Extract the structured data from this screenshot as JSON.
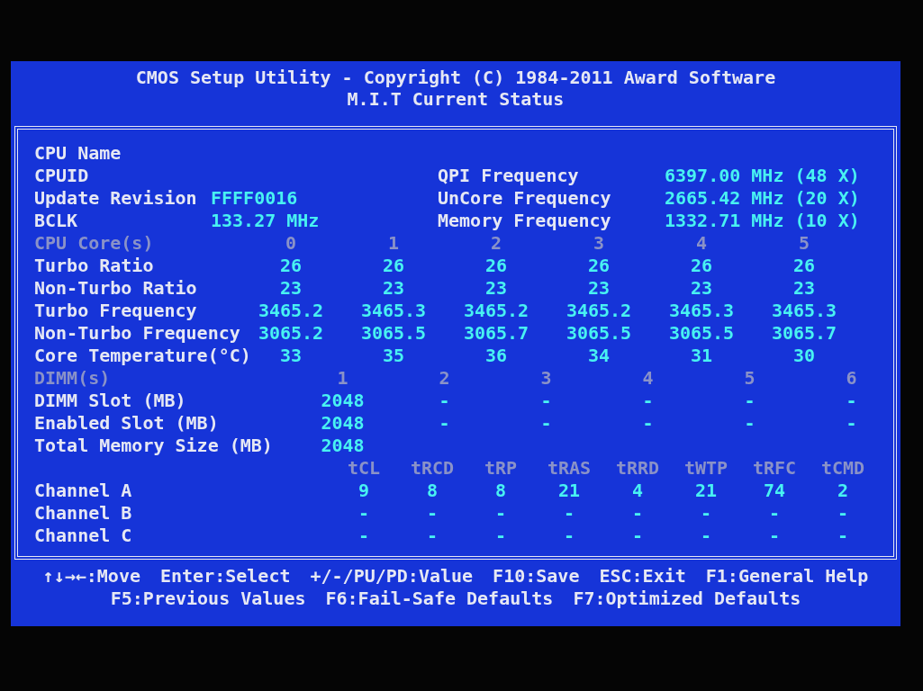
{
  "header": {
    "title": "CMOS Setup Utility - Copyright (C) 1984-2011 Award Software",
    "subtitle": "M.I.T Current Status"
  },
  "cpu_info": {
    "left": [
      {
        "label": "CPU Name"
      },
      {
        "label": "CPUID"
      },
      {
        "label": "Update Revision",
        "value": "FFFF0016"
      },
      {
        "label": "BCLK",
        "value": "133.27 MHz"
      }
    ],
    "right": [
      {
        "label": "QPI Frequency",
        "value": "6397.00 MHz (48 X)"
      },
      {
        "label": "UnCore Frequency",
        "value": "2665.42 MHz (20 X)"
      },
      {
        "label": "Memory Frequency",
        "value": "1332.71 MHz (10 X)"
      }
    ]
  },
  "cpu_cores": {
    "heading": "CPU Core(s)",
    "columns": [
      "0",
      "1",
      "2",
      "3",
      "4",
      "5"
    ],
    "rows": [
      {
        "label": "Turbo Ratio",
        "values": [
          "26",
          "26",
          "26",
          "26",
          "26",
          "26"
        ]
      },
      {
        "label": "Non-Turbo Ratio",
        "values": [
          "23",
          "23",
          "23",
          "23",
          "23",
          "23"
        ]
      },
      {
        "label": "Turbo Frequency",
        "values": [
          "3465.2",
          "3465.3",
          "3465.2",
          "3465.2",
          "3465.3",
          "3465.3"
        ]
      },
      {
        "label": "Non-Turbo Frequency",
        "values": [
          "3065.2",
          "3065.5",
          "3065.7",
          "3065.5",
          "3065.5",
          "3065.7"
        ]
      },
      {
        "label": "Core Temperature(°C)",
        "values": [
          "33",
          "35",
          "36",
          "34",
          "31",
          "30"
        ]
      }
    ]
  },
  "dimms": {
    "heading": "DIMM(s)",
    "columns": [
      "1",
      "2",
      "3",
      "4",
      "5",
      "6"
    ],
    "rows": [
      {
        "label": "DIMM Slot (MB)",
        "values": [
          "2048",
          "-",
          "-",
          "-",
          "-",
          "-"
        ]
      },
      {
        "label": "Enabled Slot (MB)",
        "values": [
          "2048",
          "-",
          "-",
          "-",
          "-",
          "-"
        ]
      },
      {
        "label": "Total Memory Size (MB)",
        "values": [
          "2048"
        ]
      }
    ]
  },
  "timings": {
    "columns": [
      "tCL",
      "tRCD",
      "tRP",
      "tRAS",
      "tRRD",
      "tWTP",
      "tRFC",
      "tCMD"
    ],
    "rows": [
      {
        "label": "Channel A",
        "values": [
          "9",
          "8",
          "8",
          "21",
          "4",
          "21",
          "74",
          "2"
        ]
      },
      {
        "label": "Channel B",
        "values": [
          "-",
          "-",
          "-",
          "-",
          "-",
          "-",
          "-",
          "-"
        ]
      },
      {
        "label": "Channel C",
        "values": [
          "-",
          "-",
          "-",
          "-",
          "-",
          "-",
          "-",
          "-"
        ]
      }
    ]
  },
  "footer": {
    "lines": [
      [
        "↑↓→←:Move",
        "Enter:Select",
        "+/-/PU/PD:Value",
        "F10:Save",
        "ESC:Exit",
        "F1:General Help"
      ],
      [
        "F5:Previous Values",
        "F6:Fail-Safe Defaults",
        "F7:Optimized Defaults"
      ]
    ]
  }
}
